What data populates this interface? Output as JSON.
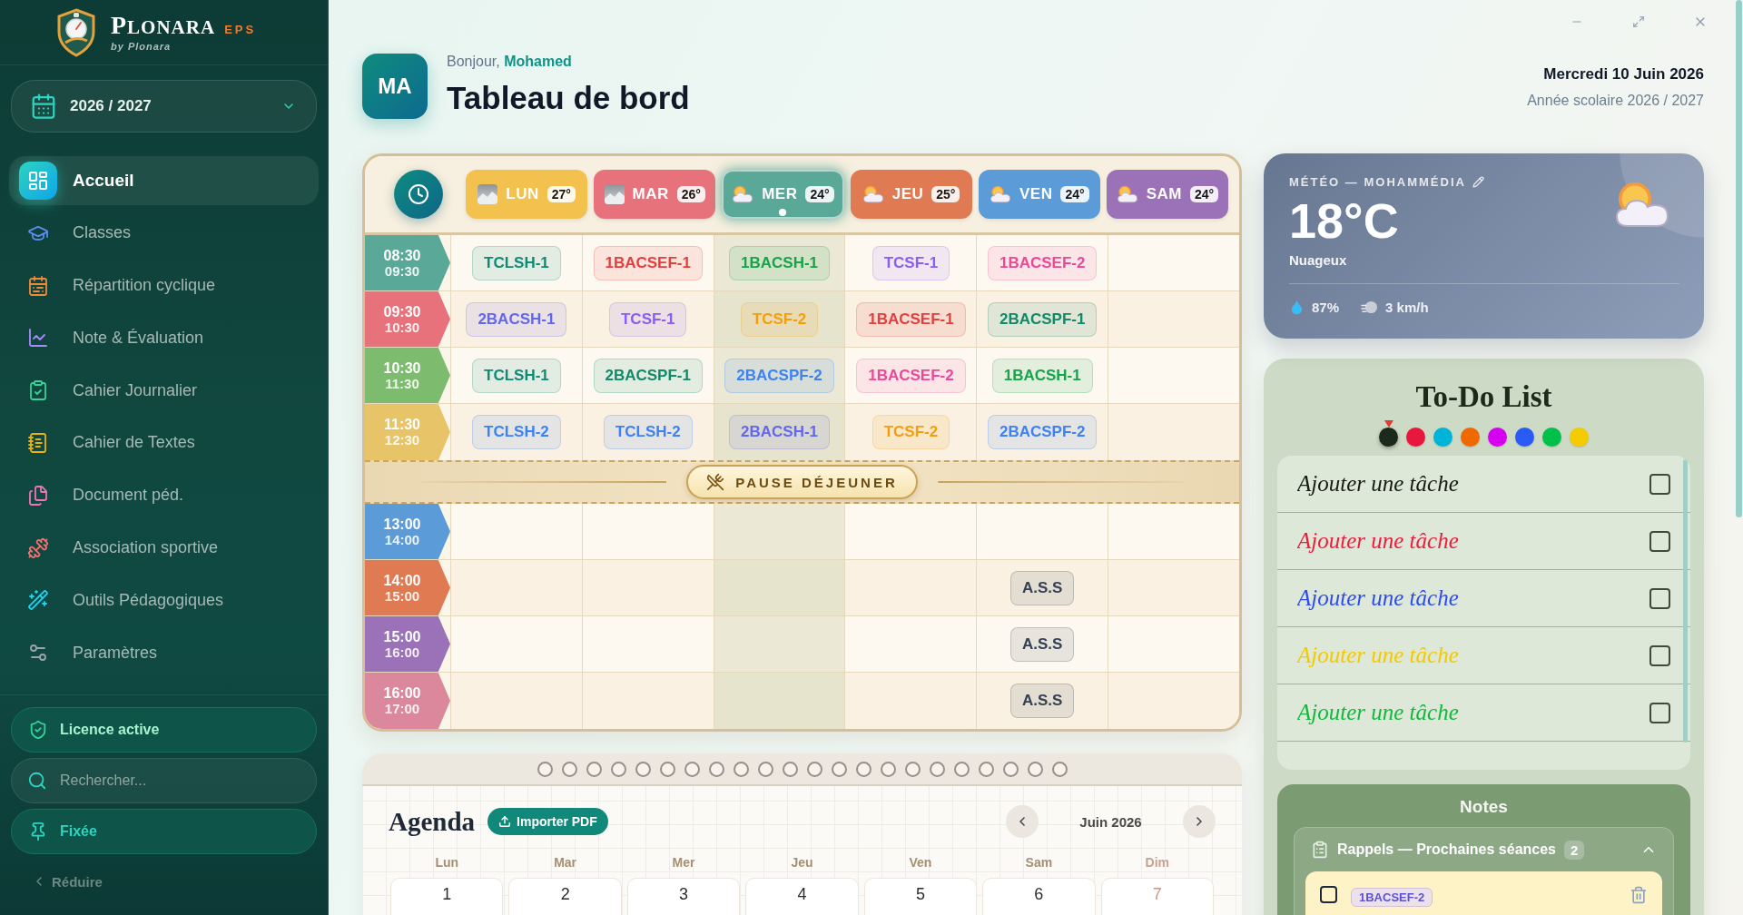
{
  "sidebar": {
    "brand": {
      "name": "PLONARA",
      "suffix": "EPS",
      "tagline": "by Plonara"
    },
    "year": "2026 / 2027",
    "nav": [
      {
        "label": "Accueil",
        "selected": true
      },
      {
        "label": "Classes",
        "selected": false
      },
      {
        "label": "Répartition cyclique",
        "selected": false
      },
      {
        "label": "Note & Évaluation",
        "selected": false
      },
      {
        "label": "Cahier Journalier",
        "selected": false
      },
      {
        "label": "Cahier de Textes",
        "selected": false
      },
      {
        "label": "Document péd.",
        "selected": false
      },
      {
        "label": "Association sportive",
        "selected": false
      },
      {
        "label": "Outils Pédagogiques",
        "selected": false
      },
      {
        "label": "Paramètres",
        "selected": false
      }
    ],
    "licence": "Licence active",
    "search": {
      "placeholder": "Rechercher..."
    },
    "pin": "Fixée",
    "collapse": "Réduire"
  },
  "header": {
    "avatar": "MA",
    "greeting": "Bonjour, **Mohamed**",
    "title": "Tableau de bord",
    "date": "Mercredi 10 Juin 2026",
    "school_year": "Année scolaire 2026 / 2027"
  },
  "schedule": {
    "days": [
      {
        "label": "LUN",
        "temp": "27°",
        "kind": "fog",
        "color": "#f2c14e",
        "selected": false
      },
      {
        "label": "MAR",
        "temp": "26°",
        "kind": "fog",
        "color": "#e8727c",
        "selected": false
      },
      {
        "label": "MER",
        "temp": "24°",
        "kind": "cloudy",
        "color": "#5aa898",
        "selected": true
      },
      {
        "label": "JEU",
        "temp": "25°",
        "kind": "cloudy",
        "color": "#e07a52",
        "selected": false
      },
      {
        "label": "VEN",
        "temp": "24°",
        "kind": "cloudy",
        "color": "#5b9bd8",
        "selected": false
      },
      {
        "label": "SAM",
        "temp": "24°",
        "kind": "cloudy",
        "color": "#9b72b8",
        "selected": false
      }
    ],
    "morning": [
      {
        "start": "08:30",
        "end": "09:30",
        "color": "#5aa898",
        "cells": [
          {
            "kind": "class",
            "label": "TCLSH-1",
            "color": "#0f8a74"
          },
          {
            "kind": "class",
            "label": "1BACSEF-1",
            "color": "#e53e3e"
          },
          {
            "kind": "class",
            "label": "1BACSH-1",
            "color": "#16a34a"
          },
          {
            "kind": "class",
            "label": "TCSF-1",
            "color": "#8b5cf6"
          },
          {
            "kind": "class",
            "label": "1BACSEF-2",
            "color": "#ec4899"
          },
          {
            "kind": "empty"
          }
        ]
      },
      {
        "start": "09:30",
        "end": "10:30",
        "color": "#e8727c",
        "cells": [
          {
            "kind": "class",
            "label": "2BACSH-1",
            "color": "#6366f1"
          },
          {
            "kind": "class",
            "label": "TCSF-1",
            "color": "#8b5cf6"
          },
          {
            "kind": "class",
            "label": "TCSF-2",
            "color": "#f59e0b"
          },
          {
            "kind": "class",
            "label": "1BACSEF-1",
            "color": "#e53e3e"
          },
          {
            "kind": "class",
            "label": "2BACSPF-1",
            "color": "#0f8a6a"
          },
          {
            "kind": "empty"
          }
        ]
      },
      {
        "start": "10:30",
        "end": "11:30",
        "color": "#7dbb6e",
        "cells": [
          {
            "kind": "class",
            "label": "TCLSH-1",
            "color": "#0f8a74"
          },
          {
            "kind": "class",
            "label": "2BACSPF-1",
            "color": "#0f8a6a"
          },
          {
            "kind": "class",
            "label": "2BACSPF-2",
            "color": "#3b82f6"
          },
          {
            "kind": "class",
            "label": "1BACSEF-2",
            "color": "#ec4899"
          },
          {
            "kind": "class",
            "label": "1BACSH-1",
            "color": "#16a34a"
          },
          {
            "kind": "empty"
          }
        ]
      },
      {
        "start": "11:30",
        "end": "12:30",
        "color": "#e8c468",
        "cells": [
          {
            "kind": "class",
            "label": "TCLSH-2",
            "color": "#3b82f6"
          },
          {
            "kind": "class",
            "label": "TCLSH-2",
            "color": "#3b82f6"
          },
          {
            "kind": "class",
            "label": "2BACSH-1",
            "color": "#6366f1"
          },
          {
            "kind": "class",
            "label": "TCSF-2",
            "color": "#f59e0b"
          },
          {
            "kind": "class",
            "label": "2BACSPF-2",
            "color": "#3b82f6"
          },
          {
            "kind": "empty"
          }
        ]
      }
    ],
    "break": "PAUSE DÉJEUNER",
    "afternoon": [
      {
        "start": "13:00",
        "end": "14:00",
        "color": "#5b9bd8",
        "cells": [
          {
            "kind": "empty"
          },
          {
            "kind": "empty"
          },
          {
            "kind": "empty"
          },
          {
            "kind": "empty"
          },
          {
            "kind": "empty"
          },
          {
            "kind": "empty"
          }
        ]
      },
      {
        "start": "14:00",
        "end": "15:00",
        "color": "#e07a52",
        "cells": [
          {
            "kind": "empty"
          },
          {
            "kind": "empty"
          },
          {
            "kind": "empty"
          },
          {
            "kind": "empty"
          },
          {
            "kind": "class",
            "label": "A.S.S",
            "color": "#334155"
          },
          {
            "kind": "empty"
          }
        ]
      },
      {
        "start": "15:00",
        "end": "16:00",
        "color": "#9b72b8",
        "cells": [
          {
            "kind": "empty"
          },
          {
            "kind": "empty"
          },
          {
            "kind": "empty"
          },
          {
            "kind": "empty"
          },
          {
            "kind": "class",
            "label": "A.S.S",
            "color": "#334155"
          },
          {
            "kind": "empty"
          }
        ]
      },
      {
        "start": "16:00",
        "end": "17:00",
        "color": "#db889c",
        "cells": [
          {
            "kind": "empty"
          },
          {
            "kind": "empty"
          },
          {
            "kind": "empty"
          },
          {
            "kind": "empty"
          },
          {
            "kind": "class",
            "label": "A.S.S",
            "color": "#334155"
          },
          {
            "kind": "empty"
          }
        ]
      }
    ]
  },
  "agenda": {
    "title": "Agenda",
    "import_button": "Importer PDF",
    "month": "Juin 2026",
    "weekdays": [
      {
        "label": "Lun",
        "sunday": false
      },
      {
        "label": "Mar",
        "sunday": false
      },
      {
        "label": "Mer",
        "sunday": false
      },
      {
        "label": "Jeu",
        "sunday": false
      },
      {
        "label": "Ven",
        "sunday": false
      },
      {
        "label": "Sam",
        "sunday": false
      },
      {
        "label": "Dim",
        "sunday": true
      }
    ],
    "days": [
      {
        "label": "1",
        "sunday": false
      },
      {
        "label": "2",
        "sunday": false
      },
      {
        "label": "3",
        "sunday": false
      },
      {
        "label": "4",
        "sunday": false
      },
      {
        "label": "5",
        "sunday": false
      },
      {
        "label": "6",
        "sunday": false
      },
      {
        "label": "7",
        "sunday": true
      }
    ]
  },
  "weather": {
    "title": "MÉTÉO — MOHAMMÉDIA",
    "temperature": "18°C",
    "condition": "Nuageux",
    "humidity": "87%",
    "wind": "3 km/h"
  },
  "todo": {
    "title": "To-Do List",
    "colors": [
      {
        "color": "#1b2a1b",
        "selected": true
      },
      {
        "color": "#e8173c",
        "selected": false
      },
      {
        "color": "#00b4d8",
        "selected": false
      },
      {
        "color": "#f06800",
        "selected": false
      },
      {
        "color": "#d500f0",
        "selected": false
      },
      {
        "color": "#2a5cf5",
        "selected": false
      },
      {
        "color": "#00c04b",
        "selected": false
      },
      {
        "color": "#f2cc00",
        "selected": false
      }
    ],
    "tasks": [
      {
        "placeholder": "Ajouter une tâche",
        "color": "#141c14",
        "checked": false
      },
      {
        "placeholder": "Ajouter une tâche",
        "color": "#ee1c3c",
        "checked": false
      },
      {
        "placeholder": "Ajouter une tâche",
        "color": "#2e4bf0",
        "checked": false
      },
      {
        "placeholder": "Ajouter une tâche",
        "color": "#f5c800",
        "checked": false
      },
      {
        "placeholder": "Ajouter une tâche",
        "color": "#12b83e",
        "checked": false
      }
    ]
  },
  "notes": {
    "title": "Notes",
    "section": {
      "title": "Rappels — Prochaines séances",
      "count": "2",
      "expanded": true,
      "items": [
        {
          "tag": "1BACSEF-2",
          "checked": false
        }
      ]
    }
  }
}
